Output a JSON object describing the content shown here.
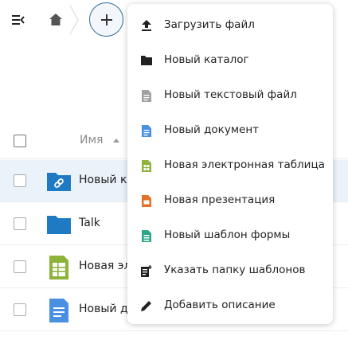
{
  "new_menu": {
    "items": [
      {
        "label": "Загрузить файл"
      },
      {
        "label": "Новый каталог"
      },
      {
        "label": "Новый текстовый файл"
      },
      {
        "label": "Новый документ"
      },
      {
        "label": "Новая электронная таблица"
      },
      {
        "label": "Новая презентация"
      },
      {
        "label": "Новый шаблон формы"
      },
      {
        "label": "Указать папку шаблонов"
      },
      {
        "label": "Добавить описание"
      }
    ]
  },
  "file_list": {
    "name_header": "Имя",
    "rows": [
      {
        "name": "Новый к",
        "icon": "shared-folder-icon",
        "selected": true
      },
      {
        "name": "Talk",
        "icon": "folder-icon",
        "selected": false
      },
      {
        "name": "Новая эл",
        "icon": "spreadsheet-icon",
        "selected": false
      },
      {
        "name": "Новый д",
        "icon": "document-icon",
        "selected": false
      }
    ]
  },
  "colors": {
    "folder_blue": "#1f7ac4",
    "spreadsheet_green": "#8db33a",
    "document_blue": "#4a90e2",
    "presentation_orange": "#e2722a",
    "form_teal": "#2fa58a",
    "text_file_grey": "#a0a0a0",
    "selected_row": "#eaf2fa"
  }
}
